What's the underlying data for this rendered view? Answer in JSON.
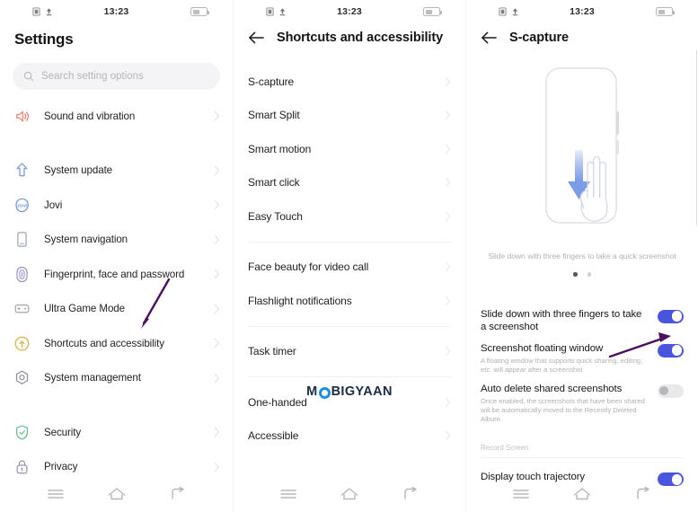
{
  "status_bar": {
    "time": "13:23",
    "left_icons": [
      "screenshot-icon",
      "upload-icon"
    ],
    "battery_icon": "battery-icon"
  },
  "colors": {
    "toggle_on": "#4a55de",
    "toggle_off": "#e9e9ec",
    "annotation_arrow": "#4b1060",
    "watermark_ring": "#1e90e0",
    "accent_blue": "#8aa9ea"
  },
  "panel_settings": {
    "title": "Settings",
    "search": {
      "placeholder": "Search setting options",
      "icon": "search-icon"
    },
    "groups": [
      {
        "items": [
          {
            "label": "Sound and vibration",
            "icon": "speaker-icon",
            "color": "#e88a7d"
          }
        ]
      },
      {
        "items": [
          {
            "label": "System update",
            "icon": "up-arrow-icon",
            "color": "#7f9fe0"
          },
          {
            "label": "Jovi",
            "icon": "jovi-icon",
            "color": "#6f93dd"
          },
          {
            "label": "System navigation",
            "icon": "phone-nav-icon",
            "color": "#9aa3bd"
          },
          {
            "label": "Fingerprint, face and password",
            "icon": "fingerprint-icon",
            "color": "#9b93c4"
          },
          {
            "label": "Ultra Game Mode",
            "icon": "gamepad-icon",
            "color": "#a3a3ad"
          },
          {
            "label": "Shortcuts and accessibility",
            "icon": "hand-gesture-icon",
            "color": "#d8b24a"
          },
          {
            "label": "System management",
            "icon": "hex-gear-icon",
            "color": "#8f8f9c"
          }
        ]
      },
      {
        "items": [
          {
            "label": "Security",
            "icon": "shield-check-icon",
            "color": "#69bf8e"
          },
          {
            "label": "Privacy",
            "icon": "lock-icon",
            "color": "#9a93b5"
          }
        ]
      }
    ]
  },
  "panel_shortcuts": {
    "title": "Shortcuts and accessibility",
    "back_icon": "back-arrow-icon",
    "groups": [
      {
        "items": [
          "S-capture",
          "Smart Split",
          "Smart motion",
          "Smart click",
          "Easy Touch"
        ]
      },
      {
        "items": [
          "Face beauty for video call",
          "Flashlight notifications"
        ]
      },
      {
        "items": [
          "Task timer"
        ]
      },
      {
        "items": [
          "One-handed",
          "Accessible"
        ]
      }
    ],
    "watermark": {
      "before": "M",
      "ring": "O",
      "after": "BIGYAAN"
    }
  },
  "panel_scapture": {
    "title": "S-capture",
    "back_icon": "back-arrow-icon",
    "illustration": {
      "icon": "phone-three-finger-swipe-illustration",
      "caption": "Slide down with three fingers to take a quick screenshot"
    },
    "page_dots": {
      "count": 2,
      "active_index": 0
    },
    "settings": [
      {
        "title": "Slide down with three fingers to take a screenshot",
        "desc": "",
        "toggle": "on"
      },
      {
        "title": "Screenshot floating window",
        "desc": "A floating window that supports quick sharing, editing, etc. will appear after a screenshot",
        "toggle": "on"
      },
      {
        "title": "Auto delete shared screenshots",
        "desc": "Once enabled, the screenshots that have been shared will be automatically moved to the Recently Deleted Album.",
        "toggle": "off"
      }
    ],
    "section_label": "Record Screen",
    "record_settings": [
      {
        "title": "Display touch trajectory",
        "desc": "",
        "toggle": "on"
      }
    ]
  },
  "navbar": {
    "recents_icon": "menu-icon",
    "home_icon": "home-icon",
    "back_icon": "back-nav-icon"
  }
}
